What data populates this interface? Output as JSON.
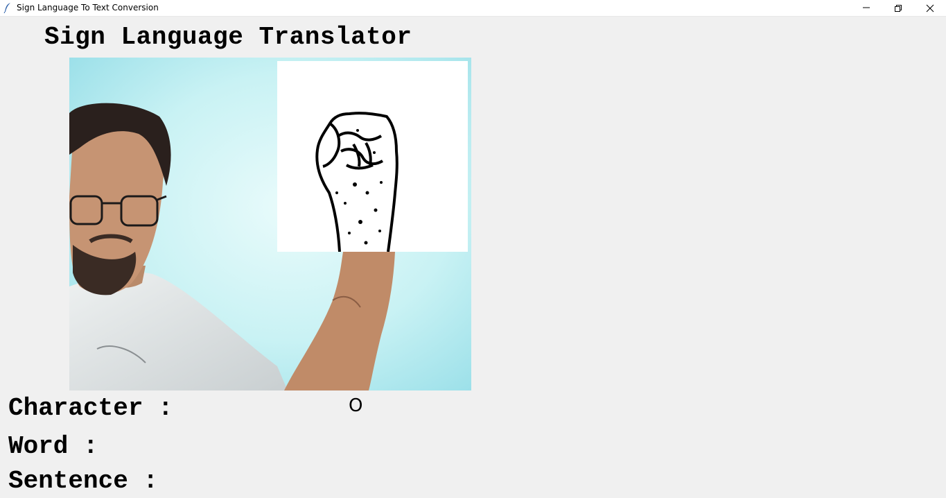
{
  "window": {
    "title": "Sign Language To Text Conversion",
    "icon": "feather-icon",
    "controls": [
      "minimize-icon",
      "maximize-icon",
      "close-icon"
    ]
  },
  "app": {
    "heading": "Sign Language Translator"
  },
  "camera": {
    "feed_description_icon": "webcam-feed",
    "hand_panel_icon": "hand-skeleton-fist"
  },
  "output": {
    "character_label": "Character :",
    "character_value": "O",
    "word_label": "Word :",
    "word_value": "",
    "sentence_label": "Sentence :",
    "sentence_value": ""
  },
  "colors": {
    "background": "#f0f0f0",
    "camera_wall": "#bdeff2",
    "shirt": "#e6e9ea"
  }
}
